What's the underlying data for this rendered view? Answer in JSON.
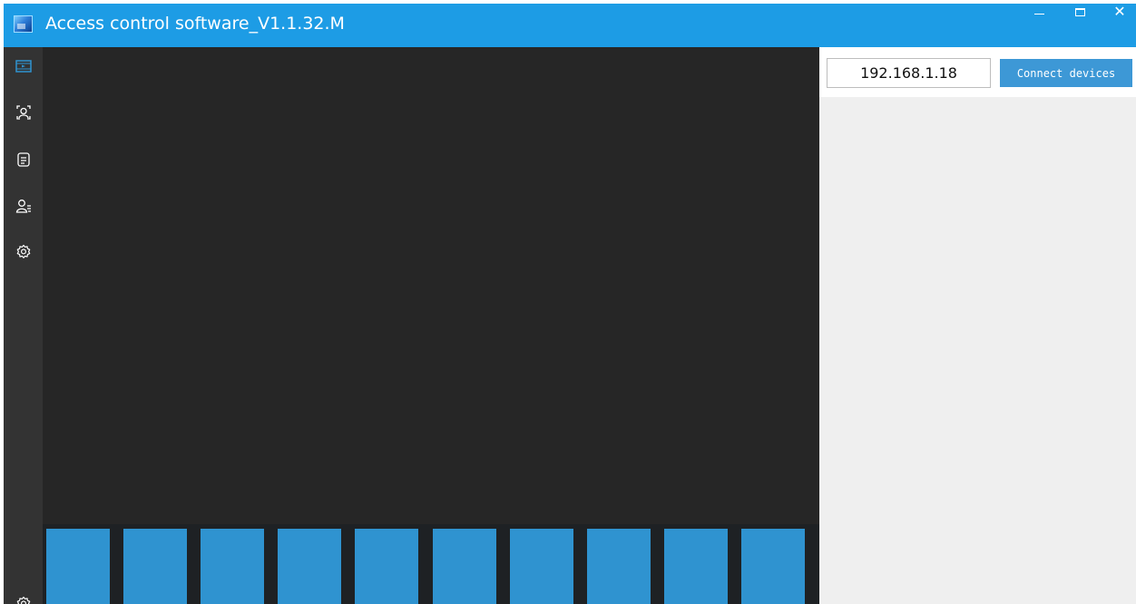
{
  "window": {
    "title": "Access control software_V1.1.32.M",
    "controls": {
      "minimize_icon": "minimize-icon",
      "maximize_icon": "maximize-icon",
      "close_glyph": "✕"
    }
  },
  "sidebar": {
    "items": [
      {
        "name": "live-video",
        "icon": "video-icon",
        "active": true
      },
      {
        "name": "face-recognition",
        "icon": "face-icon",
        "active": false
      },
      {
        "name": "records",
        "icon": "document-icon",
        "active": false
      },
      {
        "name": "personnel",
        "icon": "user-list-icon",
        "active": false
      },
      {
        "name": "settings",
        "icon": "gear-icon",
        "active": false
      }
    ],
    "bottom_icon": "gear-icon"
  },
  "video": {
    "thumbnail_count": 10
  },
  "connection": {
    "ip_value": "192.168.1.18",
    "connect_label": "Connect devices"
  },
  "colors": {
    "titlebar": "#1d9ce5",
    "sidebar": "#333333",
    "video_bg": "#262626",
    "thumb": "#2f93d0",
    "button": "#3d98d6",
    "panel_bg": "#efefef"
  }
}
